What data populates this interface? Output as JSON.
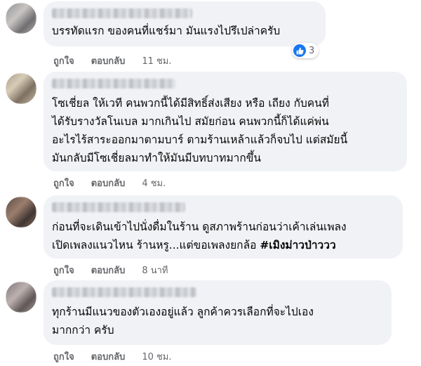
{
  "comments": [
    {
      "text": "บรรทัดแรก ของคนที่แชร์มา มันแรงไปรึเปล่าครับ",
      "like_label": "ถูกใจ",
      "reply_label": "ตอบกลับ",
      "time": "11 ชม.",
      "reaction_count": "3",
      "reaction_icon": "like-icon"
    },
    {
      "lines": [
        "โซเชี่ยล ให้เวที คนพวกนี้ได้มีสิทธิ์ส่งเสียง หรือ เถียง กับคนที่",
        "ได้รับรางวัลโนเบล มากเกินไป สมัยก่อน คนพวกนี้ก็ได้แค่พ่น",
        "อะไรไร้สาระออกมาตามบาร์ ตามร้านเหล้าแล้วก็จบไป แต่สมัยนี้",
        "มันกลับมีโซเชี่ยลมาทำให้มันมีบทบาทมากขึ้น"
      ],
      "like_label": "ถูกใจ",
      "reply_label": "ตอบกลับ",
      "time": "4 ชม."
    },
    {
      "line1": "ก่อนที่จะเดินเข้าไปนั่งดื่มในร้าน ดูสภาพร้านก่อนว่าเค้าเล่นเพลง",
      "line2": "เปิดเพลงแนวไหน ร้านหรู...แต่ขอเพลงยกล้อ ",
      "hashtag": "#เมิงม่าวป่าววว",
      "like_label": "ถูกใจ",
      "reply_label": "ตอบกลับ",
      "time": "8 นาที"
    },
    {
      "lines": [
        "ทุกร้านมีแนวของตัวเองอยู่แล้ว ลูกค้าควรเลือกที่จะไปเอง",
        "มากกว่า ครับ"
      ],
      "like_label": "ถูกใจ",
      "reply_label": "ตอบกลับ",
      "time": "10 ชม."
    }
  ],
  "colors": {
    "bubble": "#f0f2f5",
    "meta_text": "#65676b",
    "like_blue": "#1877f2"
  }
}
